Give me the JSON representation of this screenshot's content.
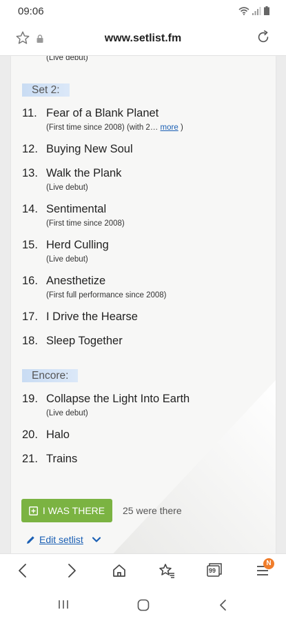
{
  "status": {
    "time": "09:06"
  },
  "browser": {
    "url": "www.setlist.fm",
    "tabs_badge": "N",
    "tab_count": "99"
  },
  "setlist": {
    "top_note": "(Live debut)",
    "set2_label": "Set 2:",
    "encore_label": "Encore:",
    "songs": [
      {
        "num": "11.",
        "title": "Fear of a Blank Planet",
        "note": "(First time since 2008) (with 2…",
        "more": "more",
        "close": ")"
      },
      {
        "num": "12.",
        "title": "Buying New Soul"
      },
      {
        "num": "13.",
        "title": "Walk the Plank",
        "note": "(Live debut)"
      },
      {
        "num": "14.",
        "title": "Sentimental",
        "note": "(First time since 2008)"
      },
      {
        "num": "15.",
        "title": "Herd Culling",
        "note": "(Live debut)"
      },
      {
        "num": "16.",
        "title": "Anesthetize",
        "note": "(First full performance since 2008)"
      },
      {
        "num": "17.",
        "title": "I Drive the Hearse"
      },
      {
        "num": "18.",
        "title": "Sleep Together"
      },
      {
        "num": "19.",
        "title": "Collapse the Light Into Earth",
        "note": "(Live debut)"
      },
      {
        "num": "20.",
        "title": "Halo"
      },
      {
        "num": "21.",
        "title": "Trains"
      }
    ],
    "i_was_there": "I WAS THERE",
    "were_there": "25 were there",
    "edit_setlist": "Edit setlist"
  }
}
